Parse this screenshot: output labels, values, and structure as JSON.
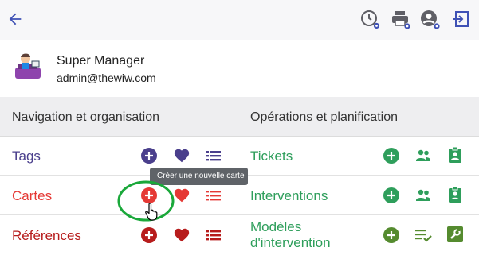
{
  "user": {
    "name": "Super Manager",
    "email": "admin@thewiw.com"
  },
  "left_header": "Navigation et organisation",
  "right_header": "Opérations et planification",
  "left_rows": [
    {
      "label": "Tags",
      "color": "#4a3f8c"
    },
    {
      "label": "Cartes",
      "color": "#e53935"
    },
    {
      "label": "Références",
      "color": "#b71c1c"
    }
  ],
  "right_rows": [
    {
      "label": "Tickets"
    },
    {
      "label": "Interventions"
    },
    {
      "label_line1": "Modèles",
      "label_line2": "d'intervention"
    }
  ],
  "tooltip": "Créer une nouvelle carte",
  "icons": {
    "topbar": [
      "back-arrow-icon",
      "clock-settings-icon",
      "printer-settings-icon",
      "account-settings-icon",
      "logout-icon"
    ],
    "row_actions": [
      "add-circle-icon",
      "heart-icon",
      "list-icon"
    ],
    "right_actions": [
      "add-circle-icon",
      "people-icon",
      "badge-icon",
      "list-check-icon",
      "wrench-icon"
    ]
  },
  "colors": {
    "primary_blue": "#3f51b5",
    "icon_dark": "#5f5f66",
    "green": "#2e9e5b",
    "olive_green": "#558b2f",
    "highlight_circle": "#1aa83a",
    "tooltip_bg": "#5f6368"
  }
}
